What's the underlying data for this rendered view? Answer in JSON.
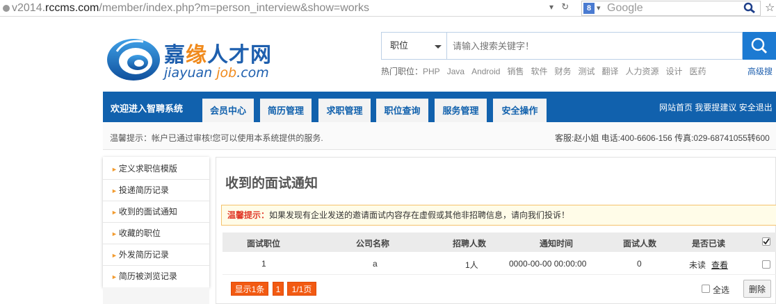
{
  "browser": {
    "url_prefix": "v2014.",
    "url_domain": "rccms.com",
    "url_rest": "/member/index.php?m=person_interview&show=works",
    "search_engine": "Google",
    "search_engine_glyph": "8"
  },
  "logo": {
    "cn_part1": "嘉",
    "cn_part2": "缘",
    "cn_part3": "人才网",
    "en_part1": "jiayuan ",
    "en_part2": "job",
    "en_part3": ".com"
  },
  "search": {
    "category": "职位",
    "placeholder": "请输入搜索关键字！",
    "hot_label": "热门职位：",
    "hot_words": [
      "PHP",
      "Java",
      "Android",
      "销售",
      "软件",
      "财务",
      "测试",
      "翻译",
      "人力资源",
      "设计",
      "医药"
    ],
    "advanced": "高级搜"
  },
  "nav": {
    "welcome": "欢迎进入智聘系统",
    "tabs": [
      "会员中心",
      "简历管理",
      "求职管理",
      "职位查询",
      "服务管理",
      "安全操作"
    ],
    "right_links": [
      "网站首页",
      "我要提建议",
      "安全退出"
    ]
  },
  "notice": {
    "left": "温馨提示：帐户已通过审核!您可以使用本系统提供的服务.",
    "right": "客服:赵小姐 电话:400-6606-156 传真:029-68741055转600"
  },
  "sidebar": {
    "items": [
      "定义求职信模版",
      "投递简历记录",
      "收到的面试通知",
      "收藏的职位",
      "外发简历记录",
      "简历被浏览记录"
    ]
  },
  "main": {
    "title": "收到的面试通知",
    "warn_label": "温馨提示：",
    "warn_text": "如果发现有企业发送的邀请面试内容存在虚假或其他非招聘信息，请向我们投诉！",
    "headers": [
      "面试职位",
      "公司名称",
      "招聘人数",
      "通知时间",
      "面试人数",
      "是否已读"
    ],
    "row": {
      "position": "1",
      "company": "a",
      "recruit": "1人",
      "time": "0000-00-00 00:00:00",
      "count": "0",
      "read": "未读",
      "view": "查看"
    },
    "pager": [
      "显示1条",
      "1",
      "1/1页"
    ],
    "select_all": "全选",
    "delete": "删除"
  },
  "colors": {
    "nav_blue": "#1161ad",
    "accent_orange": "#f25a12",
    "search_blue": "#1c7ad2"
  }
}
